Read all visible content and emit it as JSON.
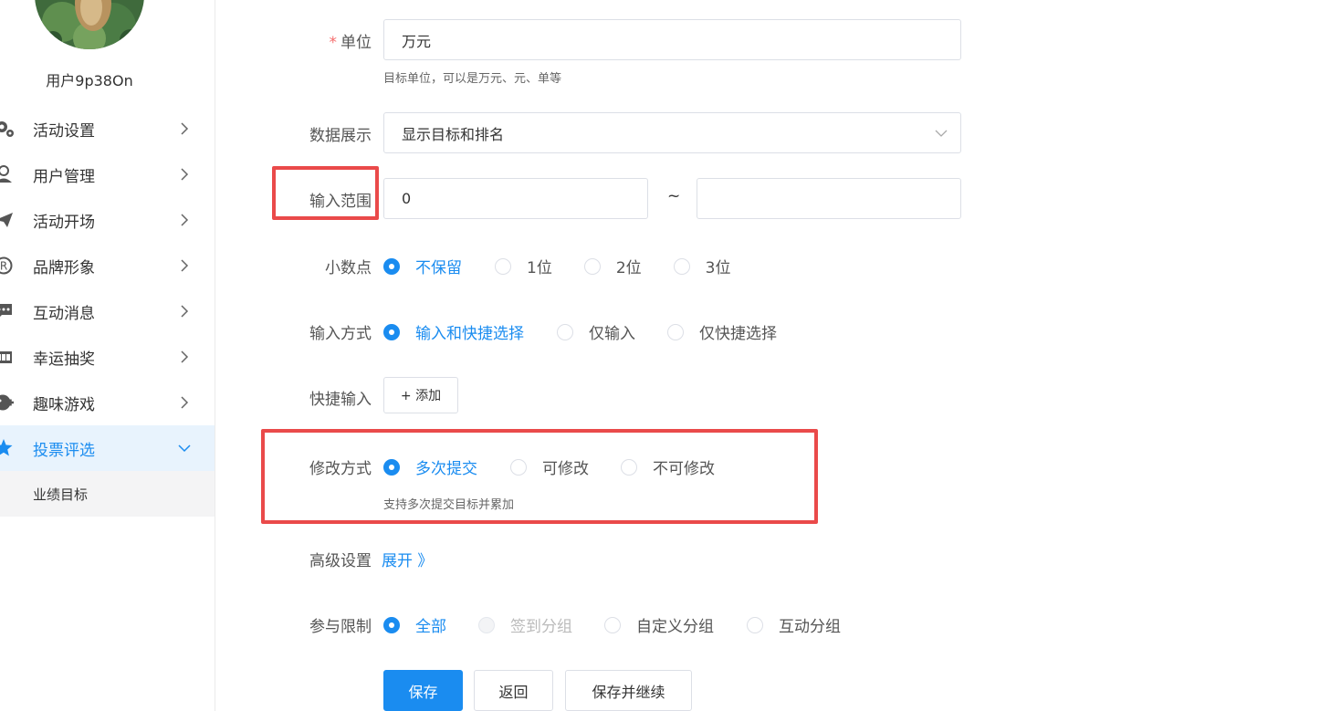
{
  "user": {
    "name": "用户9p38On"
  },
  "sidebar": {
    "items": [
      {
        "label": "活动设置",
        "icon": "gear-icon"
      },
      {
        "label": "用户管理",
        "icon": "user-icon"
      },
      {
        "label": "活动开场",
        "icon": "paper-plane-icon"
      },
      {
        "label": "品牌形象",
        "icon": "registered-icon"
      },
      {
        "label": "互动消息",
        "icon": "chat-icon"
      },
      {
        "label": "幸运抽奖",
        "icon": "lottery-icon"
      },
      {
        "label": "趣味游戏",
        "icon": "gamepad-icon"
      },
      {
        "label": "投票评选",
        "icon": "star-icon"
      }
    ],
    "sub_item": "业绩目标",
    "accent": "#1a8cf0"
  },
  "form": {
    "unit": {
      "label": "单位",
      "value": "万元",
      "hint": "目标单位，可以是万元、元、单等"
    },
    "display": {
      "label": "数据展示",
      "value": "显示目标和排名"
    },
    "range": {
      "label": "输入范围",
      "min": "0",
      "sep": "~",
      "max": ""
    },
    "decimal": {
      "label": "小数点",
      "options": [
        "不保留",
        "1位",
        "2位",
        "3位"
      ],
      "selected": 0
    },
    "input_mode": {
      "label": "输入方式",
      "options": [
        "输入和快捷选择",
        "仅输入",
        "仅快捷选择"
      ],
      "selected": 0
    },
    "quick": {
      "label": "快捷输入",
      "add_button": "+ 添加"
    },
    "modify": {
      "label": "修改方式",
      "options": [
        "多次提交",
        "可修改",
        "不可修改"
      ],
      "selected": 0,
      "hint": "支持多次提交目标并累加"
    },
    "advanced": {
      "label": "高级设置",
      "toggle": "展开 》"
    },
    "limit": {
      "label": "参与限制",
      "options": [
        "全部",
        "签到分组",
        "自定义分组",
        "互动分组"
      ],
      "selected": 0,
      "disabled": [
        1
      ]
    }
  },
  "buttons": {
    "save": "保存",
    "back": "返回",
    "save_continue": "保存并继续"
  },
  "colors": {
    "highlight": "#ea4a4a",
    "primary": "#1a8cf0",
    "required": "#f56c6c"
  }
}
